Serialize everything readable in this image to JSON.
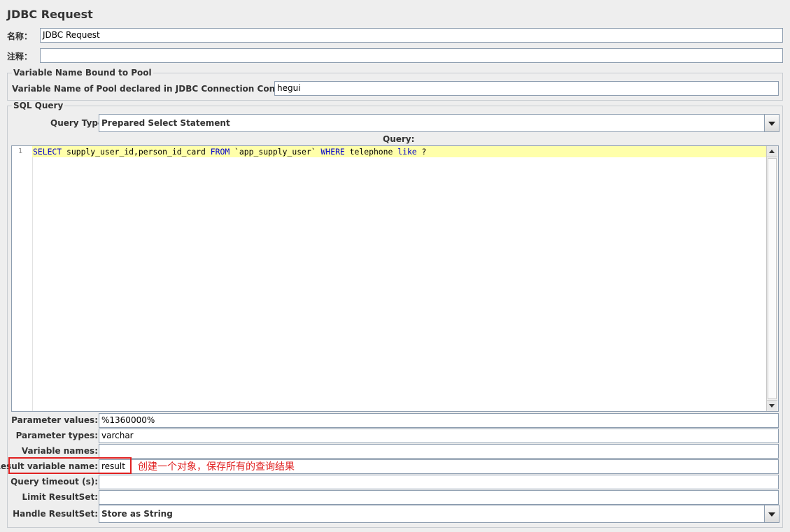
{
  "header": {
    "title": "JDBC Request"
  },
  "name_field": {
    "label": "名称：",
    "value": "JDBC Request"
  },
  "comment_field": {
    "label": "注释：",
    "value": ""
  },
  "pool_group": {
    "title": "Variable Name Bound to Pool",
    "label": "Variable Name of Pool declared in JDBC Connection Configuration:",
    "value": "hegui"
  },
  "sql_group": {
    "title": "SQL Query",
    "query_type_label": "Query Type:",
    "query_type_value": "Prepared Select Statement",
    "query_label": "Query:",
    "line_number": "1",
    "code_tokens": [
      "SELECT",
      " supply_user_id,person_id_card ",
      "FROM",
      " `app_supply_user` ",
      "WHERE",
      " telephone ",
      "like",
      " ?"
    ]
  },
  "params": {
    "parameter_values": {
      "label": "Parameter values:",
      "value": "%1360000%"
    },
    "parameter_types": {
      "label": "Parameter types:",
      "value": "varchar"
    },
    "variable_names": {
      "label": "Variable names:",
      "value": ""
    },
    "result_variable_name": {
      "label": "Result variable name:",
      "value": "result"
    },
    "query_timeout": {
      "label": "Query timeout (s):",
      "value": ""
    },
    "limit_resultset": {
      "label": "Limit ResultSet:",
      "value": ""
    },
    "handle_resultset": {
      "label": "Handle ResultSet:",
      "value": "Store as String"
    }
  },
  "annotation": {
    "text": "创建一个对象，保存所有的查询结果",
    "color": "#e02020"
  },
  "colors": {
    "keyword": "#0000cc",
    "current_line": "#ffffaa",
    "annotation_red": "#e02020"
  }
}
